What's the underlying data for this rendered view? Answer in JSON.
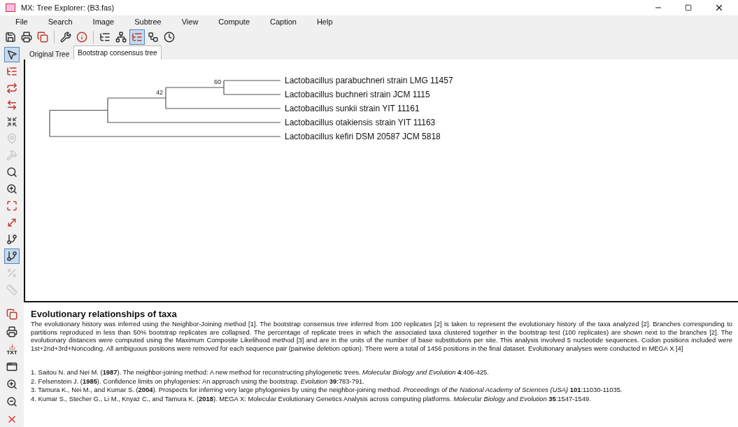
{
  "window": {
    "title": "MX: Tree Explorer: (B3.fas)"
  },
  "menu": [
    "File",
    "Search",
    "Image",
    "Subtree",
    "View",
    "Compute",
    "Caption",
    "Help"
  ],
  "toolbar": [
    {
      "kind": "save",
      "pressed": false
    },
    {
      "kind": "print",
      "pressed": false
    },
    {
      "kind": "copy",
      "pressed": false
    },
    {
      "kind": "sep"
    },
    {
      "kind": "wrench",
      "pressed": false
    },
    {
      "kind": "info",
      "pressed": false
    },
    {
      "kind": "sep"
    },
    {
      "kind": "tree",
      "pressed": false
    },
    {
      "kind": "tree2",
      "pressed": false
    },
    {
      "kind": "tree3",
      "pressed": true
    },
    {
      "kind": "nodes",
      "pressed": false
    },
    {
      "kind": "clock",
      "pressed": false
    }
  ],
  "side_tools": [
    {
      "kind": "pointer",
      "pressed": true,
      "disabled": false
    },
    {
      "kind": "root",
      "pressed": false,
      "disabled": false
    },
    {
      "kind": "flip",
      "pressed": false,
      "disabled": false
    },
    {
      "kind": "swap",
      "pressed": false,
      "disabled": false
    },
    {
      "kind": "compress",
      "pressed": false,
      "disabled": false
    },
    {
      "kind": "marker",
      "pressed": false,
      "disabled": true
    },
    {
      "kind": "hammer",
      "pressed": false,
      "disabled": true
    },
    {
      "kind": "find",
      "pressed": false,
      "disabled": false
    },
    {
      "kind": "zoom",
      "pressed": false,
      "disabled": false
    },
    {
      "kind": "fit",
      "pressed": false,
      "disabled": false
    },
    {
      "kind": "resize",
      "pressed": false,
      "disabled": false
    },
    {
      "kind": "branch",
      "pressed": false,
      "disabled": false
    },
    {
      "kind": "branch",
      "pressed": true,
      "disabled": false
    },
    {
      "kind": "percent",
      "pressed": false,
      "disabled": true
    },
    {
      "kind": "scale",
      "pressed": false,
      "disabled": true
    }
  ],
  "tabs": [
    {
      "label": "Original Tree",
      "selected": false
    },
    {
      "label": "Bootstrap consensus tree",
      "selected": true
    }
  ],
  "tree": {
    "children": [
      {
        "children": [
          {
            "support": "42",
            "children": [
              {
                "support": "60",
                "children": [
                  {
                    "label": "Lactobacillus parabuchneri strain LMG 11457"
                  },
                  {
                    "label": "Lactobacillus buchneri strain JCM 1115"
                  }
                ]
              },
              {
                "label": "Lactobacillus sunkii strain YIT 11161"
              }
            ]
          },
          {
            "label": "Lactobacillus otakiensis strain YIT 11163"
          }
        ]
      },
      {
        "label": "Lactobacillus kefiri DSM 20587 JCM 5818"
      }
    ]
  },
  "caption_tools": [
    {
      "kind": "copy"
    },
    {
      "kind": "print"
    },
    {
      "kind": "txt",
      "text": "TXT"
    },
    {
      "kind": "window"
    },
    {
      "kind": "zoomin"
    },
    {
      "kind": "zoomout"
    },
    {
      "kind": "close"
    }
  ],
  "caption": {
    "title": "Evolutionary relationships of taxa",
    "paragraph": "The evolutionary history was inferred using the Neighbor-Joining method [1]. The bootstrap consensus tree inferred from 100 replicates [2] is taken to represent the evolutionary history of the taxa analyzed [2]. Branches corresponding to partitions reproduced in less than 50% bootstrap replicates are collapsed. The percentage of replicate trees in which the associated taxa clustered together in the bootstrap test (100 replicates) are shown next to the branches [2]. The evolutionary distances were computed using the Maximum Composite Likelihood method [3] and are in the units of the number of base substitutions per site. This analysis involved 5 nucleotide sequences. Codon positions included were 1st+2nd+3rd+Noncoding. All ambiguous positions were removed for each sequence pair (pairwise deletion option). There were a total of 1456 positions in the final dataset. Evolutionary analyses were conducted in MEGA X [4]",
    "references": [
      "1. Saitou N. and Nei M. (**1987**). The neighbor-joining method: A new method for reconstructing phylogenetic trees. *Molecular Biology and Evolution* **4**:406-425.",
      "2. Felsenstein J. (**1985**). Confidence limits on phylogenies: An approach using the bootstrap. *Evolution* **39**:783-791.",
      "3. Tamura K., Nei M., and Kumar S. (**2004**). Prospects for inferring very large phylogenies by using the neighbor-joining method. *Proceedings of the National Academy of Sciences (USA)* **101**:11030-11035.",
      "4. Kumar S., Stecher G., Li M., Knyaz C., and Tamura K. (**2018**). MEGA X: Molecular Evolutionary Genetics Analysis across computing platforms. *Molecular Biology and Evolution* **35**:1547-1549."
    ]
  }
}
